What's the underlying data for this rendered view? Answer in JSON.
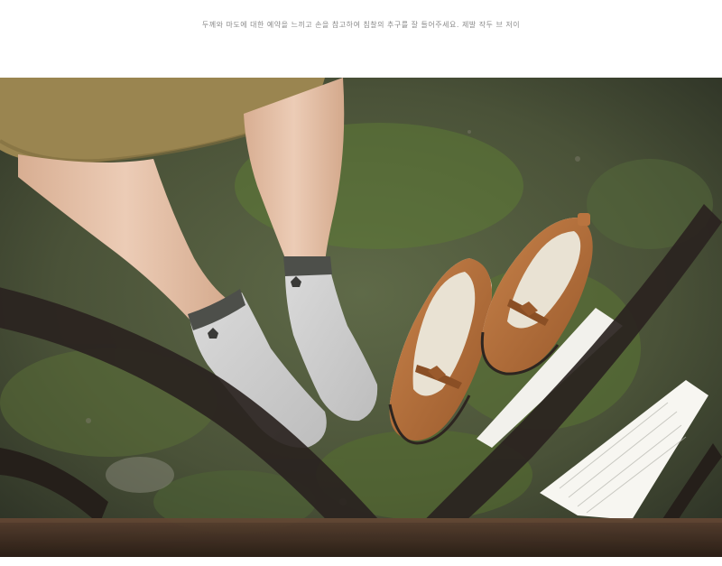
{
  "caption": {
    "text": "두께와 마도에 대한 예약을 느끼고 손을 참고하여 침찰의 추구를 잘 들어주세요. 제발 작두 브 저이"
  },
  "photo": {
    "subject": "legs-in-grey-ankle-socks-with-brown-shoes-on-mossy-ground",
    "colors": {
      "ground": "#4f5a3e",
      "moss": "#5d7a35",
      "skirt": "#9a8550",
      "skin": "#e3bfa6",
      "sock": "#cfcfcf",
      "sock_cuff": "#4d4f4a",
      "shoe": "#b9743f",
      "shoe_dark": "#7e4a24",
      "rail": "#3a2b20",
      "paper": "#f2f1ec"
    }
  }
}
